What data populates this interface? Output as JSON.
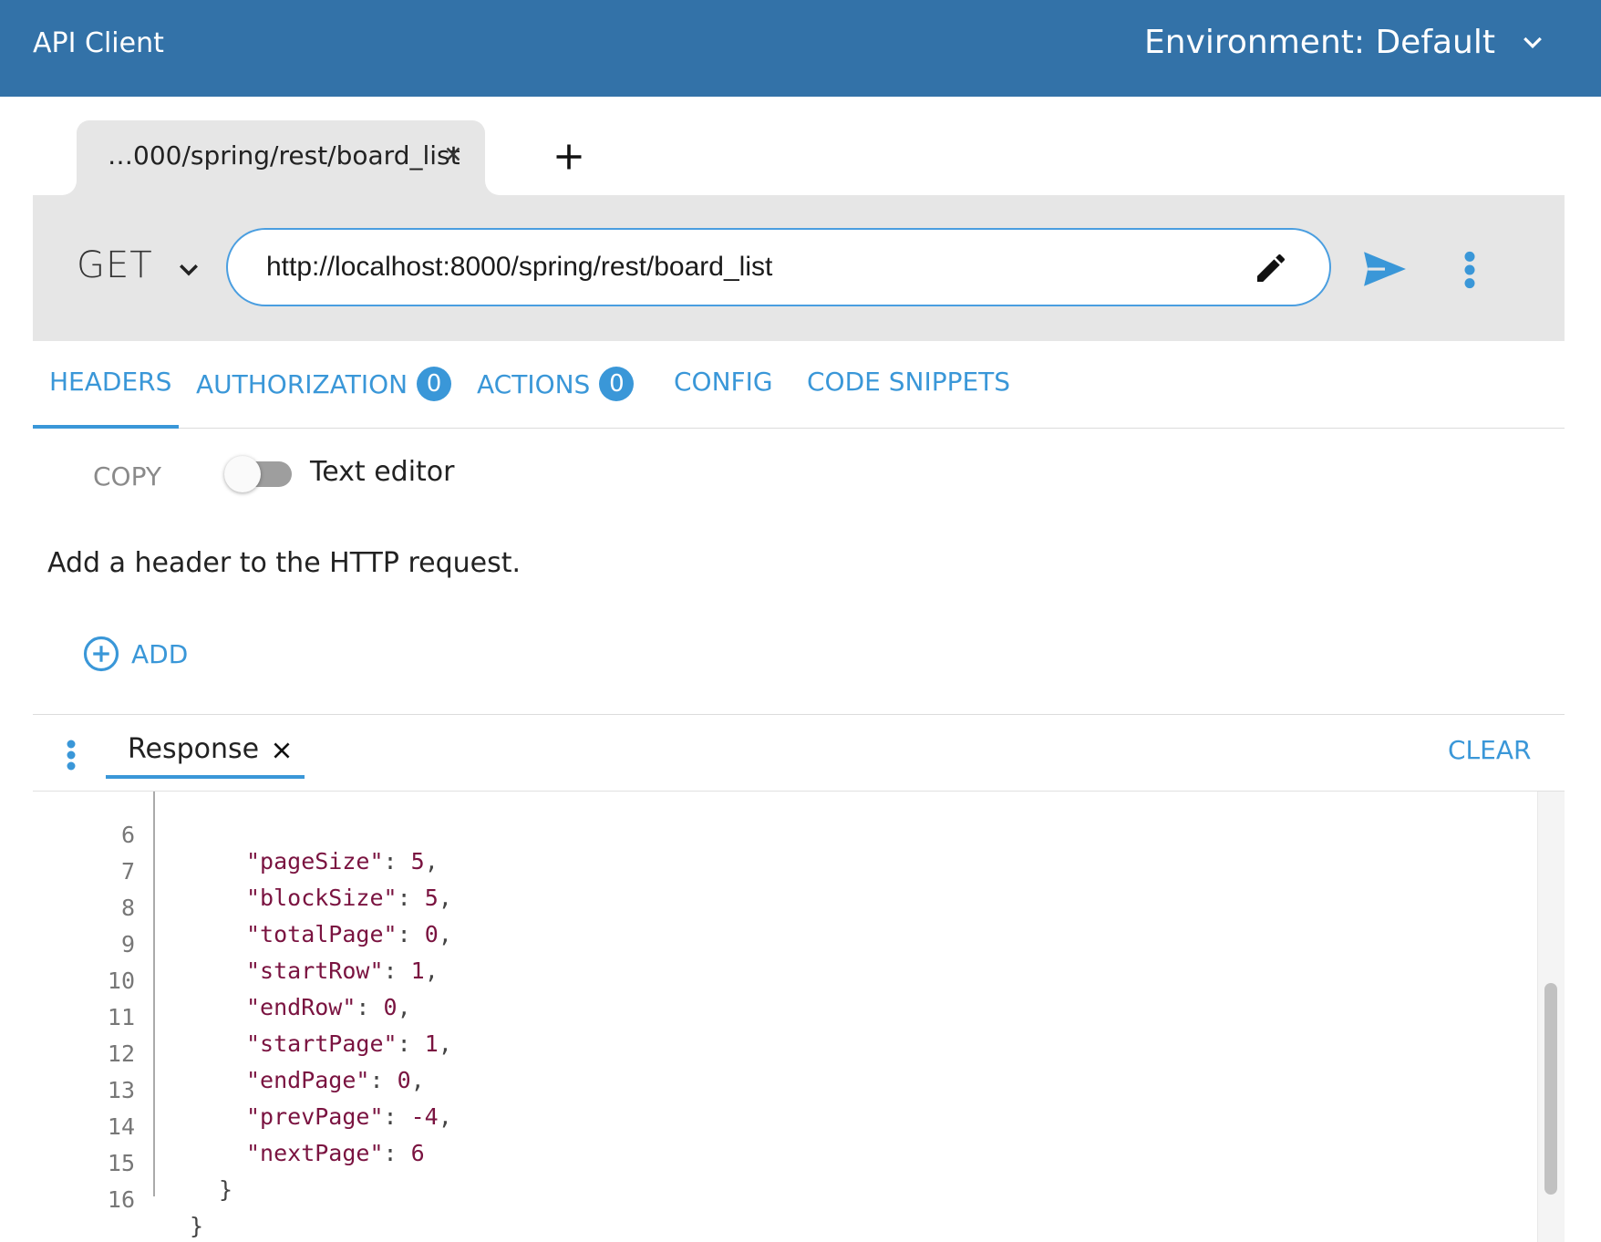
{
  "topbar": {
    "title": "API Client",
    "environment_label": "Environment: Default",
    "color": "#3372a8"
  },
  "request_tab": {
    "label": "…000/spring/rest/board_list"
  },
  "request": {
    "method": "GET",
    "url": "http://localhost:8000/spring/rest/board_list"
  },
  "sections": {
    "headers": "HEADERS",
    "authorization": "AUTHORIZATION",
    "authorization_count": "0",
    "actions": "ACTIONS",
    "actions_count": "0",
    "config": "CONFIG",
    "code_snippets": "CODE SNIPPETS",
    "accent_color": "#3a97d8"
  },
  "headers_panel": {
    "copy_label": "COPY",
    "text_editor_label": "Text editor",
    "hint": "Add a header to the HTTP request.",
    "add_label": "ADD"
  },
  "response": {
    "tab_label": "Response",
    "clear_label": "CLEAR",
    "lines": [
      {
        "n": "6",
        "key": "\"pageSize\"",
        "value": "5",
        "comma": ","
      },
      {
        "n": "7",
        "key": "\"blockSize\"",
        "value": "5",
        "comma": ","
      },
      {
        "n": "8",
        "key": "\"totalPage\"",
        "value": "0",
        "comma": ","
      },
      {
        "n": "9",
        "key": "\"startRow\"",
        "value": "1",
        "comma": ","
      },
      {
        "n": "10",
        "key": "\"endRow\"",
        "value": "0",
        "comma": ","
      },
      {
        "n": "11",
        "key": "\"startPage\"",
        "value": "1",
        "comma": ","
      },
      {
        "n": "12",
        "key": "\"endPage\"",
        "value": "0",
        "comma": ","
      },
      {
        "n": "13",
        "key": "\"prevPage\"",
        "value": "-4",
        "comma": ","
      },
      {
        "n": "14",
        "key": "\"nextPage\"",
        "value": "6",
        "comma": ""
      }
    ],
    "closing_lines": [
      {
        "n": "15",
        "text": "}"
      },
      {
        "n": "16",
        "text": "}"
      }
    ]
  }
}
